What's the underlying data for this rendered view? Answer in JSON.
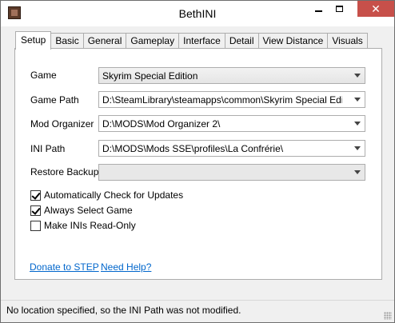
{
  "window": {
    "title": "BethINI",
    "close_glyph": "✕"
  },
  "tabs": [
    {
      "label": "Setup",
      "active": true
    },
    {
      "label": "Basic"
    },
    {
      "label": "General"
    },
    {
      "label": "Gameplay"
    },
    {
      "label": "Interface"
    },
    {
      "label": "Detail"
    },
    {
      "label": "View Distance"
    },
    {
      "label": "Visuals"
    }
  ],
  "setup": {
    "game": {
      "label": "Game",
      "value": "Skyrim Special Edition"
    },
    "game_path": {
      "label": "Game Path",
      "value": "D:\\SteamLibrary\\steamapps\\common\\Skyrim Special Edition\\"
    },
    "mod_organizer": {
      "label": "Mod Organizer",
      "value": "D:\\MODS\\Mod Organizer 2\\"
    },
    "ini_path": {
      "label": "INI Path",
      "value": "D:\\MODS\\Mods SSE\\profiles\\La Confrérie\\"
    },
    "restore_backup": {
      "label": "Restore Backup",
      "value": ""
    },
    "checkboxes": [
      {
        "label": "Automatically Check for Updates",
        "checked": true
      },
      {
        "label": "Always Select Game",
        "checked": true
      },
      {
        "label": "Make INIs Read-Only",
        "checked": false
      }
    ],
    "links": {
      "donate": "Donate to STEP",
      "help": "Need Help?"
    }
  },
  "status": {
    "text": "No location specified, so the INI Path was not modified."
  },
  "colors": {
    "close_button": "#c7504a",
    "link": "#0066cc",
    "panel": "#ffffff",
    "chrome": "#f0f0f0"
  },
  "icons": {
    "app": "bethini-app-icon",
    "minimize": "minimize-icon",
    "maximize": "maximize-icon",
    "close": "close-icon",
    "dropdown": "chevron-down-icon",
    "checkmark": "checkmark-icon"
  }
}
